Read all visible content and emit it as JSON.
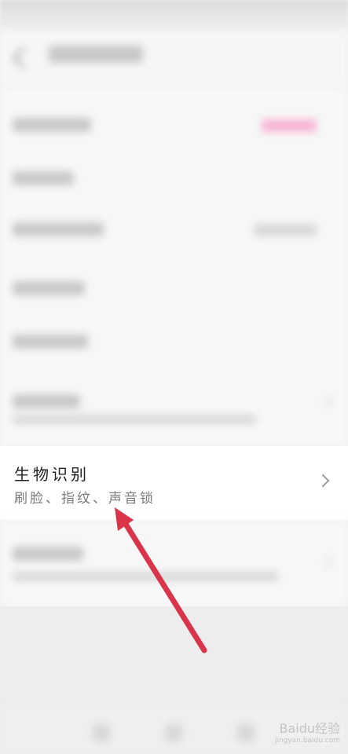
{
  "biometric": {
    "title": "生物识别",
    "subtitle": "刷脸、指纹、声音锁"
  },
  "watermark": {
    "text": "Baidu经验",
    "url": "jingyan.baidu.com"
  },
  "icons": {
    "back": "back-arrow-icon",
    "chevron": "chevron-right-icon",
    "annotation": "red-arrow-annotation"
  },
  "colors": {
    "annotation_arrow": "#d9344a",
    "toggle_accent": "#f6b3d3"
  }
}
